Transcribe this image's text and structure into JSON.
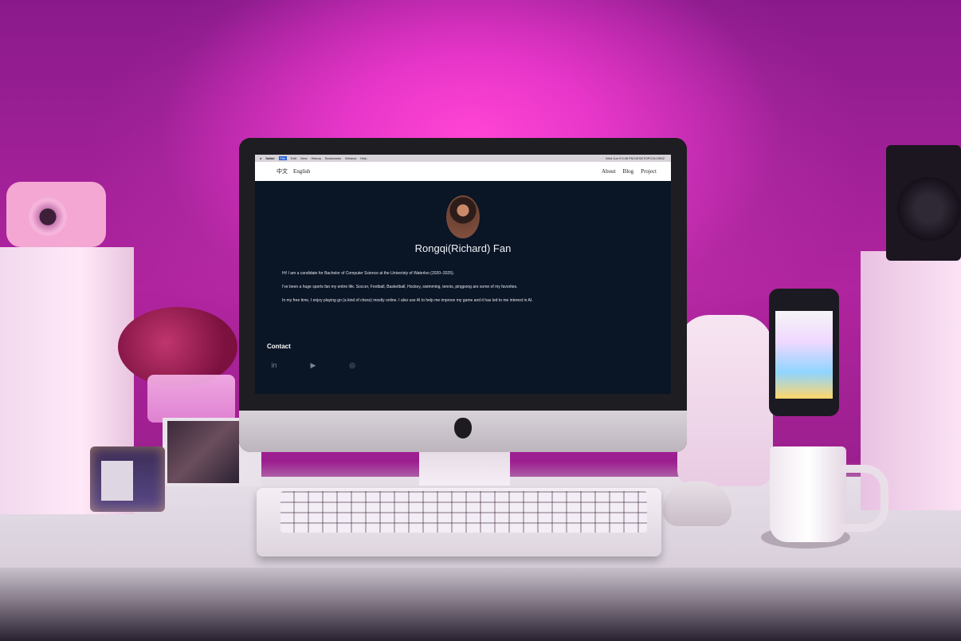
{
  "os_menubar": {
    "items": [
      "Safari",
      "File",
      "Edit",
      "View",
      "History",
      "Bookmarks",
      "Window",
      "Help"
    ],
    "status": "Wed Jun 9  9:45 PM   DESKTOPCOLOR02"
  },
  "site_nav": {
    "lang_zh": "中文",
    "lang_en": "English",
    "about": "About",
    "blog": "Blog",
    "project": "Project"
  },
  "profile": {
    "name": "Rongqi(Richard) Fan",
    "bio": [
      "Hi! I am a candidate for Bachelor of Computer Science at the Univeristy of Waterloo (2020–2025).",
      "I've been a huge sports fan my entire life. Soccer, Football, Basketball, Hockey, swimming, tennis, pingpong are some of my favorites.",
      "In my free time, I enjoy playing go (a kind of chess) mostly online. I also use AI to help me improve my game and it has led to me interest in AI."
    ]
  },
  "contact": {
    "heading": "Contact",
    "icons": [
      {
        "name": "linkedin-icon",
        "glyph": "in"
      },
      {
        "name": "youtube-icon",
        "glyph": "▶"
      },
      {
        "name": "wechat-icon",
        "glyph": "◎"
      }
    ]
  },
  "colors": {
    "screen_bg": "#0a1526",
    "ambient_pink": "#e02cc4"
  }
}
